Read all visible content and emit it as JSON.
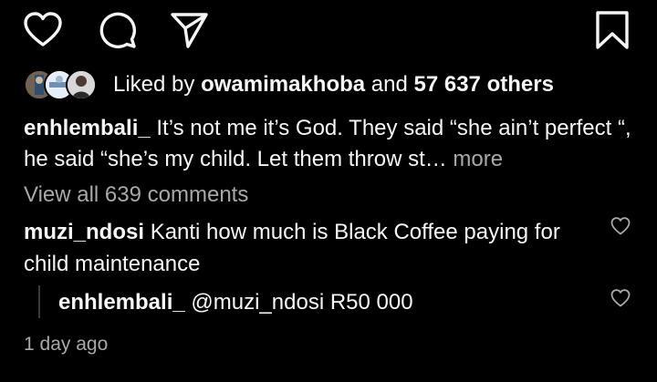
{
  "actions": {
    "like_icon": "heart-outline-icon",
    "comment_icon": "speech-bubble-icon",
    "share_icon": "paper-plane-icon",
    "save_icon": "bookmark-outline-icon"
  },
  "likes": {
    "prefix": "Liked by",
    "user": "owamimakhoba",
    "connector": "and",
    "count": "57 637 others"
  },
  "caption": {
    "username": "enhlembali_",
    "text": "It’s not me it’s God. They said “she ain’t perfect “, he said “she’s my child. Let them throw st",
    "ellipsis": "…",
    "more": "more"
  },
  "view_all_comments": "View all 639 comments",
  "comment": {
    "username": "muzi_ndosi",
    "text": "Kanti how much is Black Coffee paying for child maintenance"
  },
  "reply": {
    "username": "enhlembali_",
    "text": "@muzi_ndosi R50 000"
  },
  "timestamp": "1 day ago",
  "colors": {
    "background": "#000000",
    "text": "#f5f5f5",
    "muted": "#a8a8a8"
  }
}
